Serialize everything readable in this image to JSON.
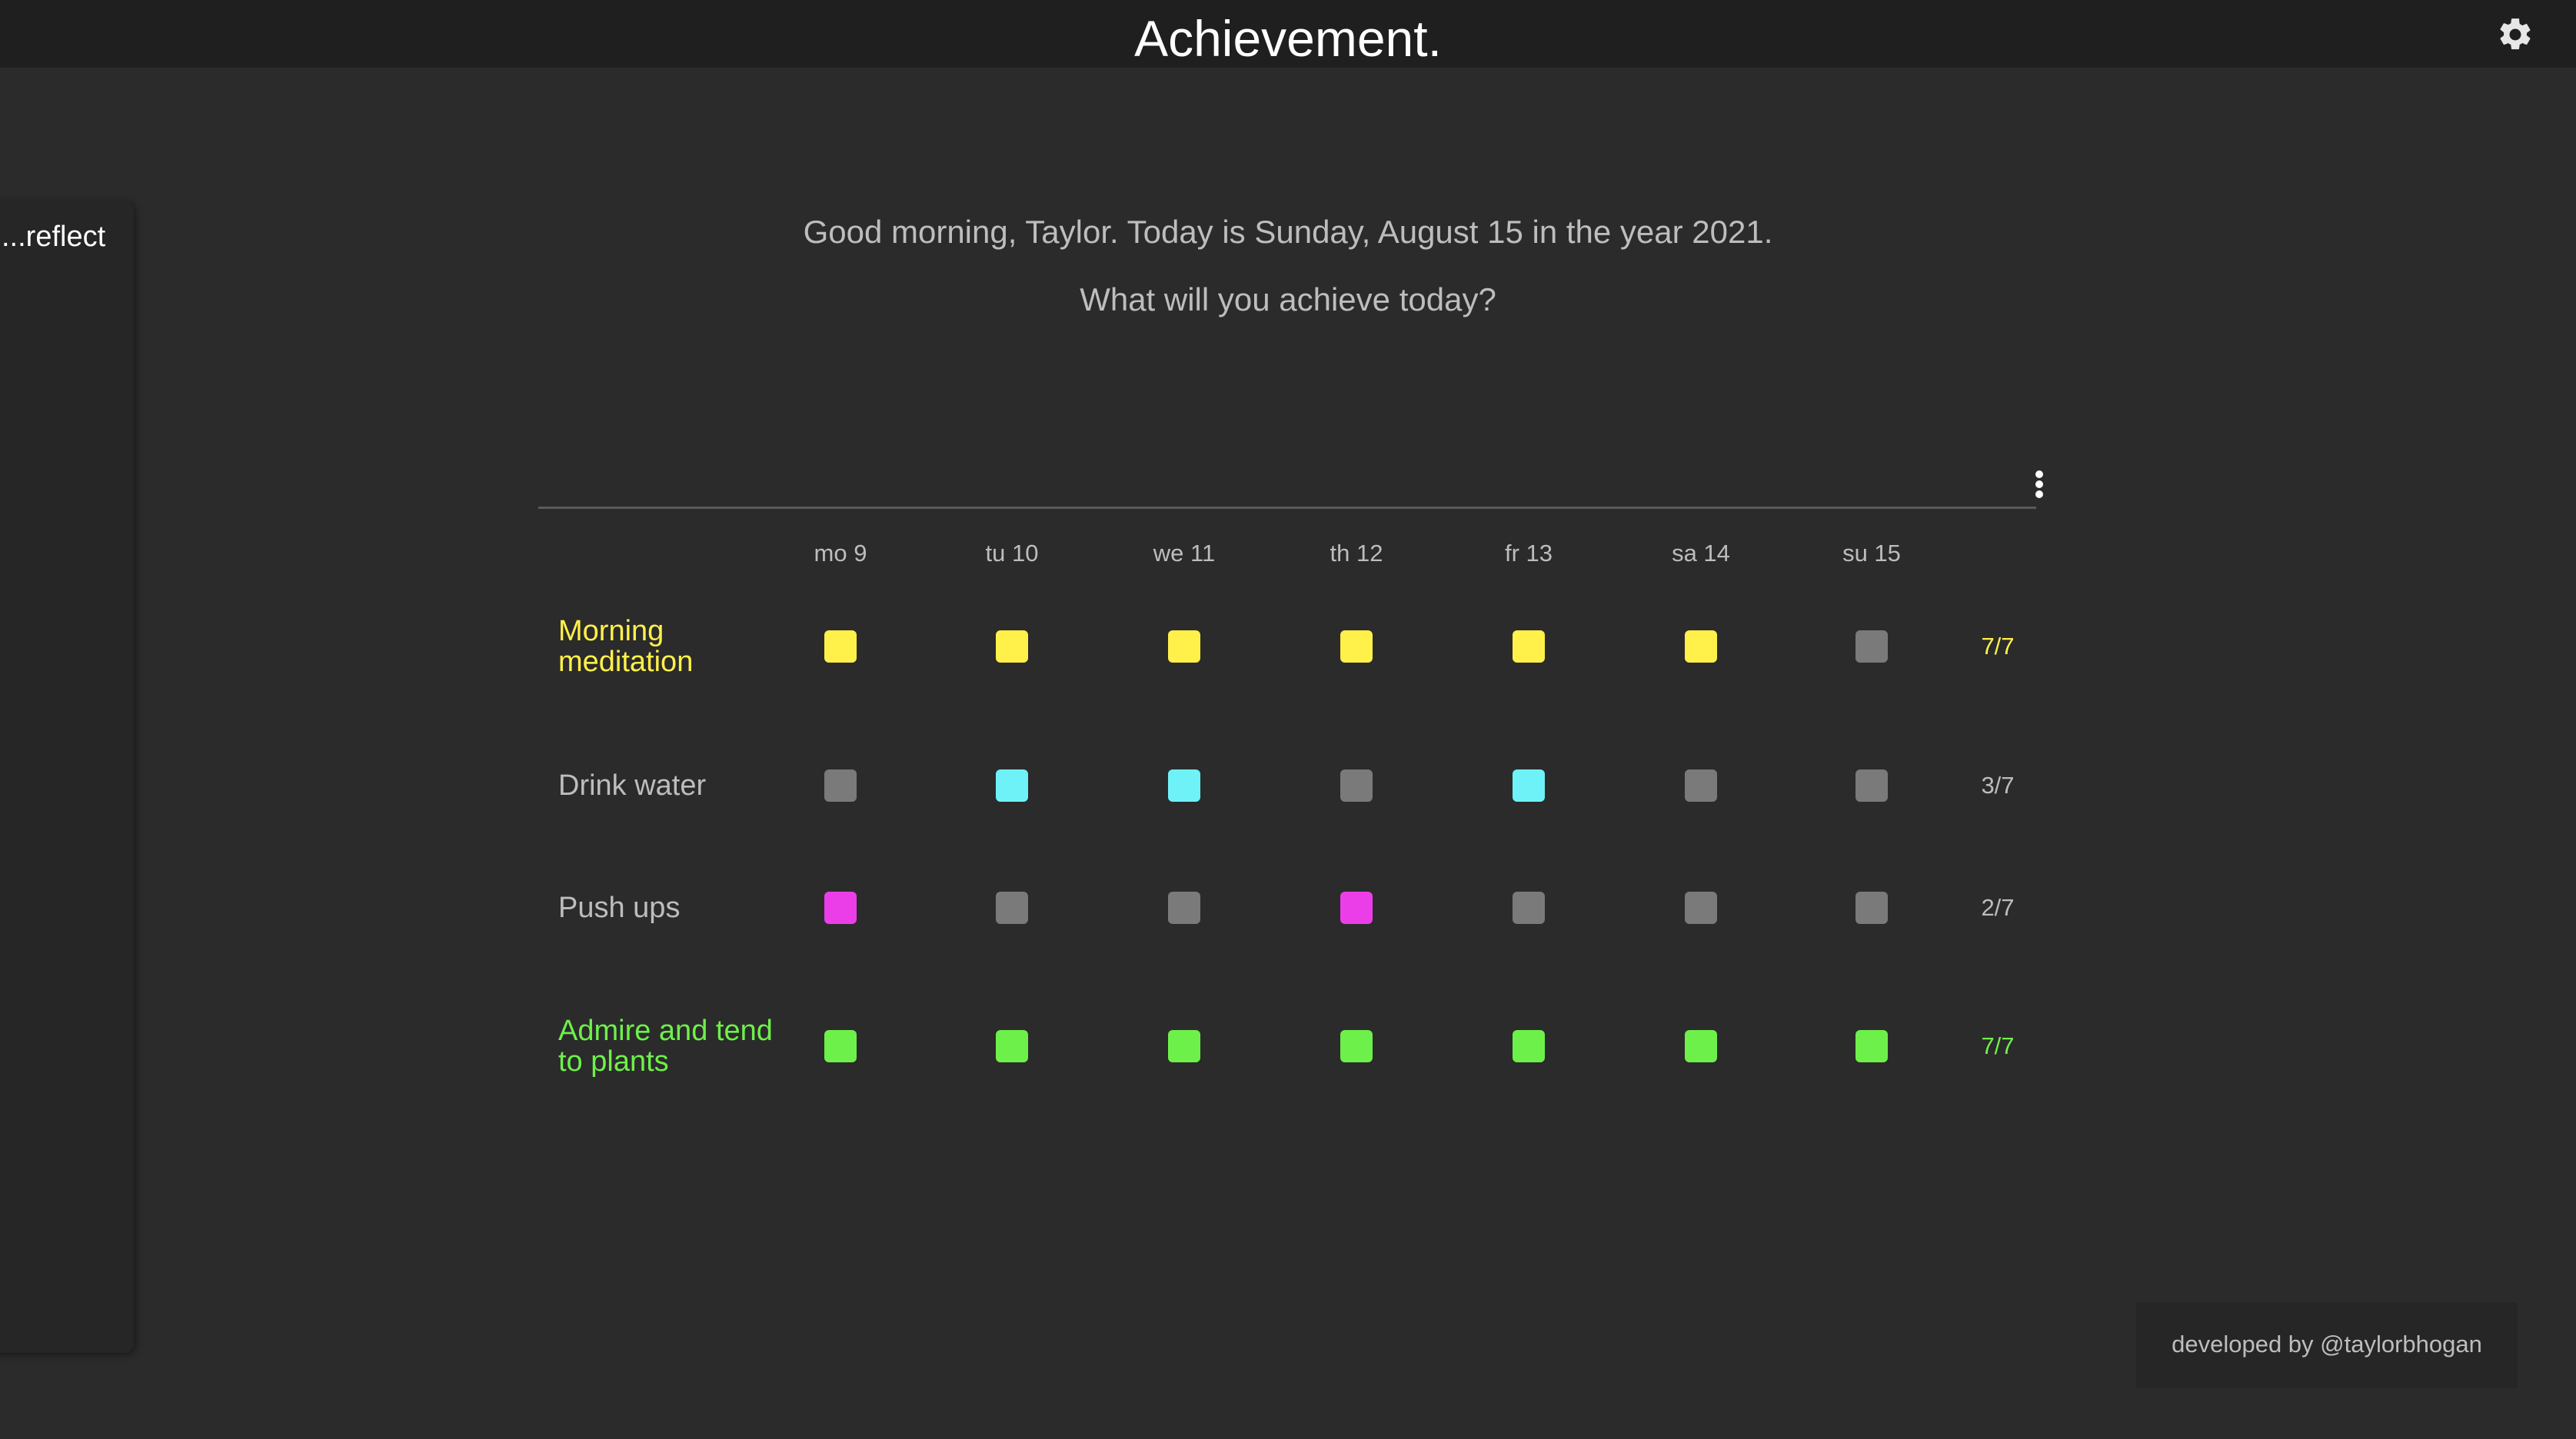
{
  "header": {
    "title": "Achievement.",
    "settings_icon": "gear-icon"
  },
  "sidebar": {
    "label": "...reflect"
  },
  "greeting": {
    "line1": "Good morning, Taylor. Today is Sunday, August 15 in the year 2021.",
    "line2": "What will you achieve today?"
  },
  "tracker": {
    "menu_icon": "more-vertical-icon",
    "days": [
      "mo 9",
      "tu 10",
      "we 11",
      "th 12",
      "fr 13",
      "sa 14",
      "su 15"
    ],
    "empty_color": "#7a7a7a",
    "habits": [
      {
        "name_lines": [
          "Morning",
          "meditation"
        ],
        "color": "#fff04a",
        "highlighted": true,
        "done": [
          true,
          true,
          true,
          true,
          true,
          true,
          false
        ],
        "count": "7/7"
      },
      {
        "name_lines": [
          "Drink water"
        ],
        "color": "#6ef2f7",
        "highlighted": false,
        "done": [
          false,
          true,
          true,
          false,
          true,
          false,
          false
        ],
        "count": "3/7"
      },
      {
        "name_lines": [
          "Push ups"
        ],
        "color": "#ec3ee8",
        "highlighted": false,
        "done": [
          true,
          false,
          false,
          true,
          false,
          false,
          false
        ],
        "count": "2/7"
      },
      {
        "name_lines": [
          "Admire and tend",
          "to plants"
        ],
        "color": "#6ef04a",
        "highlighted": true,
        "done": [
          true,
          true,
          true,
          true,
          true,
          true,
          true
        ],
        "count": "7/7"
      }
    ]
  },
  "footer": {
    "credit": "developed by @taylorbhogan"
  },
  "colors": {
    "background": "#2b2b2b",
    "topbar": "#1f1f1f",
    "muted_text": "#bdbdbd"
  }
}
